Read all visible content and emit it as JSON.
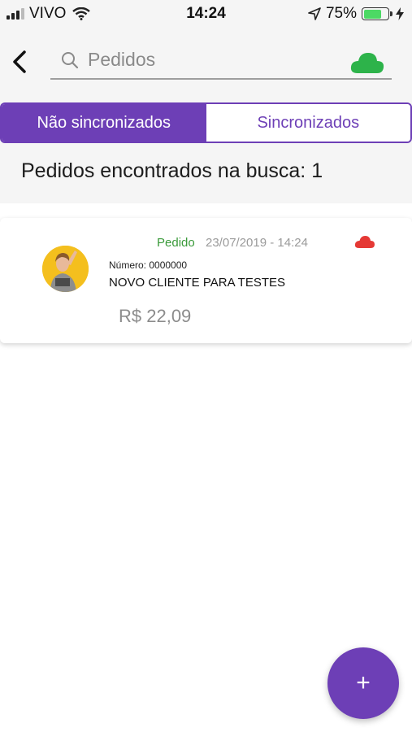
{
  "status_bar": {
    "carrier": "VIVO",
    "time": "14:24",
    "battery": "75%",
    "battery_level": 0.75
  },
  "header": {
    "search_placeholder": "Pedidos"
  },
  "tabs": [
    {
      "label": "Não sincronizados",
      "active": true
    },
    {
      "label": "Sincronizados",
      "active": false
    }
  ],
  "results": {
    "count_text": "Pedidos encontrados na busca: 1"
  },
  "orders": [
    {
      "type_label": "Pedido",
      "date": "23/07/2019 - 14:24",
      "number": "Número: 0000000",
      "client": "NOVO CLIENTE PARA TESTES",
      "price": "R$ 22,09",
      "sync_icon": "cloud-red-icon"
    }
  ],
  "fab": {
    "label": "+"
  },
  "colors": {
    "accent": "#6d3fb6",
    "synced": "#2db34a",
    "unsynced": "#e53935",
    "order_label": "#3a9a3a"
  }
}
